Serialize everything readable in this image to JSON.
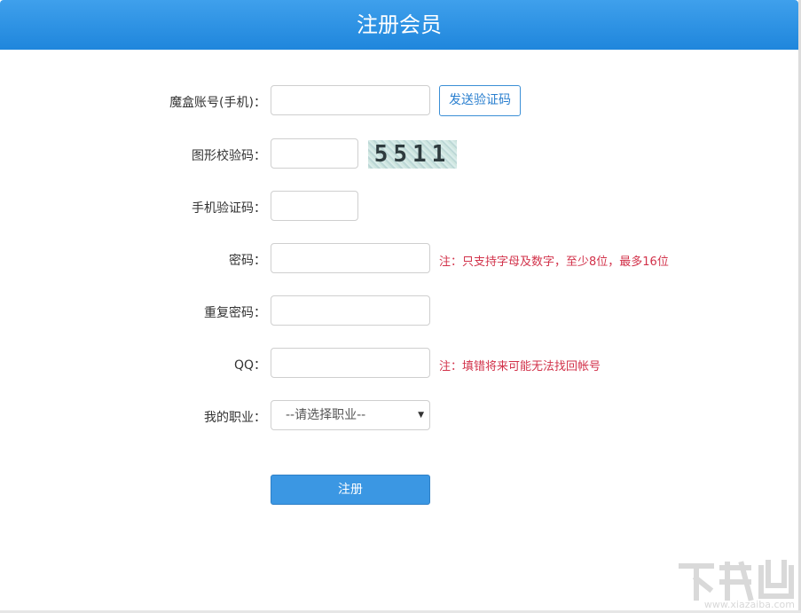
{
  "header": {
    "title": "注册会员"
  },
  "form": {
    "account_label": "魔盒账号(手机)：",
    "send_code_button": "发送验证码",
    "captcha_label": "图形校验码：",
    "captcha_text": "5511",
    "sms_code_label": "手机验证码：",
    "password_label": "密码：",
    "password_note": "注：只支持字母及数字，至少8位，最多16位",
    "repeat_password_label": "重复密码：",
    "qq_label": "QQ：",
    "qq_note": "注：填错将来可能无法找回帐号",
    "job_label": "我的职业：",
    "job_select_value": "--请选择职业--",
    "submit_button": "注册"
  },
  "watermark": {
    "text": "www.xiazaiba.com"
  }
}
